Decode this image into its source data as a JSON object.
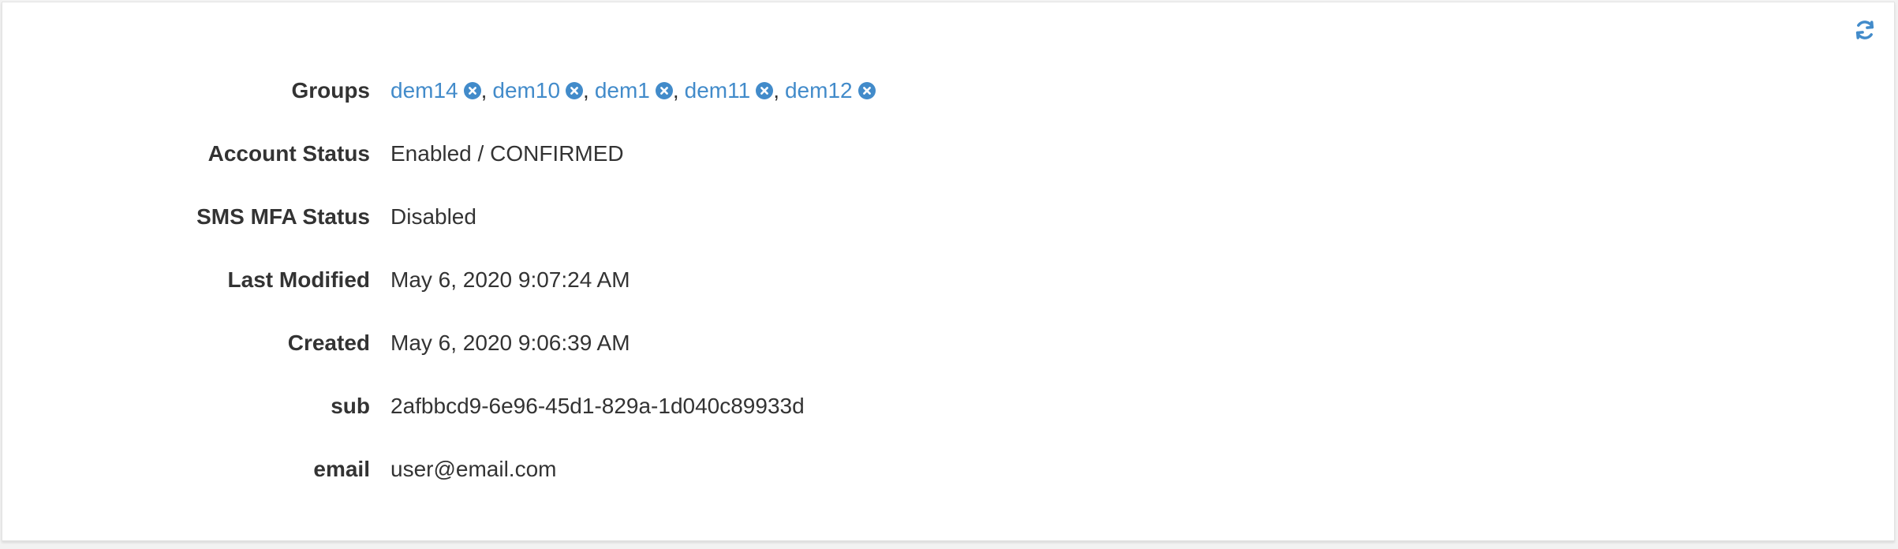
{
  "toolbar": {
    "refresh_icon": "refresh-icon",
    "accent_color": "#428bca"
  },
  "details": {
    "groups_label": "Groups",
    "groups": [
      {
        "name": "dem14"
      },
      {
        "name": "dem10"
      },
      {
        "name": "dem1"
      },
      {
        "name": "dem11"
      },
      {
        "name": "dem12"
      }
    ],
    "separator": ",",
    "account_status_label": "Account Status",
    "account_status": "Enabled / CONFIRMED",
    "sms_mfa_label": "SMS MFA Status",
    "sms_mfa": "Disabled",
    "last_modified_label": "Last Modified",
    "last_modified": "May 6, 2020 9:07:24 AM",
    "created_label": "Created",
    "created": "May 6, 2020 9:06:39 AM",
    "sub_label": "sub",
    "sub": "2afbbcd9-6e96-45d1-829a-1d040c89933d",
    "email_label": "email",
    "email": "user@email.com"
  }
}
